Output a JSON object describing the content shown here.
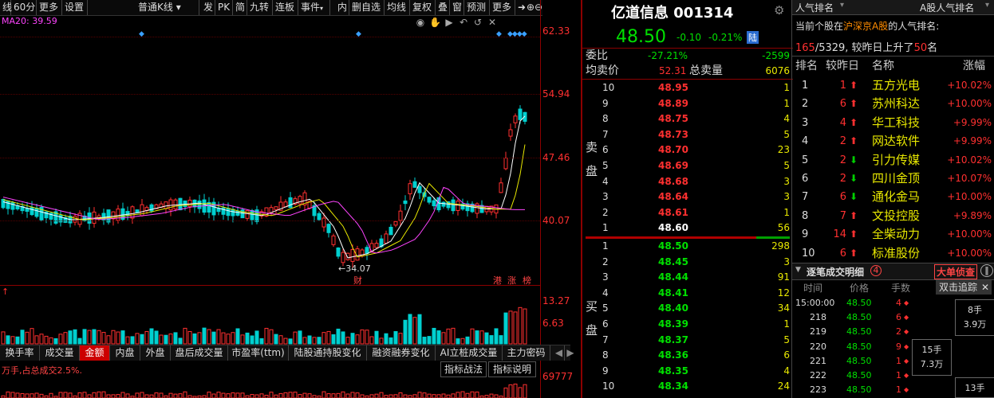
{
  "toolbar": {
    "items": [
      "线",
      "60分",
      "更多",
      "设置",
      "普通K线",
      "发",
      "PK",
      "简",
      "九转",
      "连板",
      "事件",
      "内",
      "删自选",
      "均线",
      "复权",
      "叠",
      "窗",
      "预测",
      "更多"
    ],
    "icons": [
      "arrow-right-icon",
      "plus-icon",
      "minus-icon"
    ]
  },
  "chart": {
    "ma_label": "MA20: 39.59",
    "price_labels": [
      "62.33",
      "54.94",
      "47.46",
      "40.07"
    ],
    "low_mark": "34.07",
    "cai_mark": "财",
    "tags": [
      "港",
      "涨",
      "榜"
    ],
    "vol_labels": [
      "13.27",
      "6.63"
    ],
    "indicator_labels": [
      "69777"
    ],
    "info_text": "万手,占总成交2.5%.",
    "strategy_btn": "指标战法",
    "explain_btn": "指标说明"
  },
  "tabs": [
    "换手率",
    "成交量",
    "金额",
    "内盘",
    "外盘",
    "盘后成交量",
    "市盈率(ttm)",
    "陆股通持股变化",
    "融资融券变化",
    "AI立桩成交量",
    "主力密码"
  ],
  "active_tab": "金额",
  "quote": {
    "name": "亿道信息 001314",
    "price": "48.50",
    "change": "-0.10",
    "pct": "-0.21%",
    "market_tag": "陆",
    "wb_label": "委比",
    "wb_val": "-27.21%",
    "wb_diff": "-2599",
    "avg_label": "均卖价",
    "avg_val": "52.31",
    "total_label": "总卖量",
    "total_val": "6076",
    "sell_side_label": "卖盘",
    "buy_side_label": "买盘",
    "sells": [
      {
        "lv": "10",
        "p": "48.95",
        "v": "1"
      },
      {
        "lv": "9",
        "p": "48.89",
        "v": "1"
      },
      {
        "lv": "8",
        "p": "48.75",
        "v": "4"
      },
      {
        "lv": "7",
        "p": "48.73",
        "v": "5"
      },
      {
        "lv": "6",
        "p": "48.70",
        "v": "23"
      },
      {
        "lv": "5",
        "p": "48.69",
        "v": "5"
      },
      {
        "lv": "4",
        "p": "48.68",
        "v": "3"
      },
      {
        "lv": "3",
        "p": "48.64",
        "v": "3"
      },
      {
        "lv": "2",
        "p": "48.61",
        "v": "1"
      },
      {
        "lv": "1",
        "p": "48.60",
        "v": "56"
      }
    ],
    "buys": [
      {
        "lv": "1",
        "p": "48.50",
        "v": "298"
      },
      {
        "lv": "2",
        "p": "48.45",
        "v": "3"
      },
      {
        "lv": "3",
        "p": "48.44",
        "v": "91"
      },
      {
        "lv": "4",
        "p": "48.41",
        "v": "12"
      },
      {
        "lv": "5",
        "p": "48.40",
        "v": "34"
      },
      {
        "lv": "6",
        "p": "48.39",
        "v": "1"
      },
      {
        "lv": "7",
        "p": "48.37",
        "v": "5"
      },
      {
        "lv": "8",
        "p": "48.36",
        "v": "6"
      },
      {
        "lv": "9",
        "p": "48.35",
        "v": "4"
      },
      {
        "lv": "10",
        "p": "48.34",
        "v": "24"
      }
    ]
  },
  "rank": {
    "tab1": "人气排名",
    "tab2": "A股人气排名",
    "desc1": "当前个股在",
    "desc_market": "沪深京A股",
    "desc2": "的人气排名:",
    "rank_pos": "165",
    "rank_total": "/5329, 较昨日上升了",
    "rank_up": "50",
    "rank_unit": "名",
    "headers": [
      "排名",
      "较昨日",
      "名称",
      "涨幅"
    ],
    "rows": [
      {
        "r": "1",
        "c": "1",
        "dir": "up",
        "name": "五方光电",
        "pct": "+10.02%"
      },
      {
        "r": "2",
        "c": "6",
        "dir": "up",
        "name": "苏州科达",
        "pct": "+10.00%"
      },
      {
        "r": "3",
        "c": "4",
        "dir": "up",
        "name": "华工科技",
        "pct": "+9.99%"
      },
      {
        "r": "4",
        "c": "2",
        "dir": "up",
        "name": "网达软件",
        "pct": "+9.99%"
      },
      {
        "r": "5",
        "c": "2",
        "dir": "down",
        "name": "引力传媒",
        "pct": "+10.02%"
      },
      {
        "r": "6",
        "c": "2",
        "dir": "down",
        "name": "四川金顶",
        "pct": "+10.07%"
      },
      {
        "r": "7",
        "c": "6",
        "dir": "down",
        "name": "通化金马",
        "pct": "+10.00%"
      },
      {
        "r": "8",
        "c": "7",
        "dir": "up",
        "name": "文投控股",
        "pct": "+9.89%"
      },
      {
        "r": "9",
        "c": "14",
        "dir": "up",
        "name": "全柴动力",
        "pct": "+10.00%"
      },
      {
        "r": "10",
        "c": "6",
        "dir": "up",
        "name": "标准股份",
        "pct": "+10.00%"
      }
    ],
    "trades_title": "逐笔成交明细",
    "trades_count": "4",
    "big_btn": "大单侦查",
    "dbl_btn": "双击追踪",
    "trade_headers": [
      "时间",
      "价格",
      "手数"
    ],
    "trades": [
      {
        "t": "15:00:00",
        "p": "48.50",
        "v": "4"
      },
      {
        "t": "218",
        "p": "48.50",
        "v": "6"
      },
      {
        "t": "219",
        "p": "48.50",
        "v": "2"
      },
      {
        "t": "220",
        "p": "48.50",
        "v": "9"
      },
      {
        "t": "221",
        "p": "48.50",
        "v": "1"
      },
      {
        "t": "222",
        "p": "48.50",
        "v": "1"
      },
      {
        "t": "223",
        "p": "48.50",
        "v": "1"
      }
    ],
    "popup1": [
      "8手",
      "3.9万"
    ],
    "popup2": [
      "15手",
      "7.3万"
    ],
    "popup3": [
      "13手"
    ]
  }
}
